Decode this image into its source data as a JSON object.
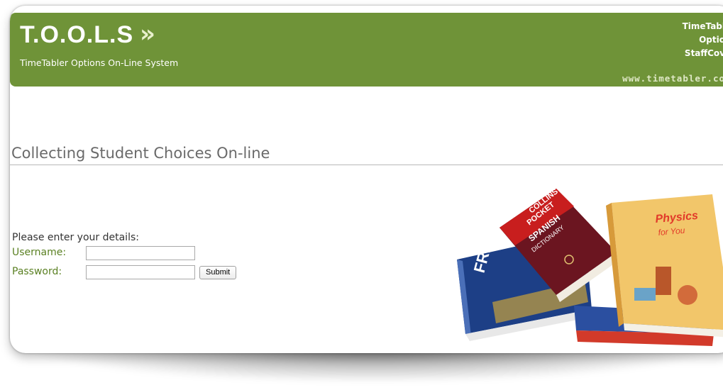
{
  "brand": {
    "logo_text": "T.O.O.L.S",
    "logo_arrow": "»",
    "tagline": "TimeTabler Options On-Line System"
  },
  "header_links": [
    "TimeTabl",
    "Optio",
    "StaffCov"
  ],
  "site_url": "www.timetabler.co",
  "page_heading": "Collecting Student Choices On-line",
  "login_form": {
    "prompt": "Please enter your details:",
    "username_label": "Username:",
    "username_value": "",
    "password_label": "Password:",
    "password_value": "",
    "submit_label": "Submit"
  },
  "books": {
    "collins_line1": "COLLINS",
    "collins_line2": "POCKET",
    "collins_line3": "SPANISH",
    "collins_line4": "DICTIONARY",
    "physics_line1": "Physics",
    "physics_line2": "for You",
    "french_label": "FRENC"
  },
  "colors": {
    "header_green": "#6f9338",
    "label_green": "#5a8022",
    "heading_gray": "#6a6a6a"
  }
}
